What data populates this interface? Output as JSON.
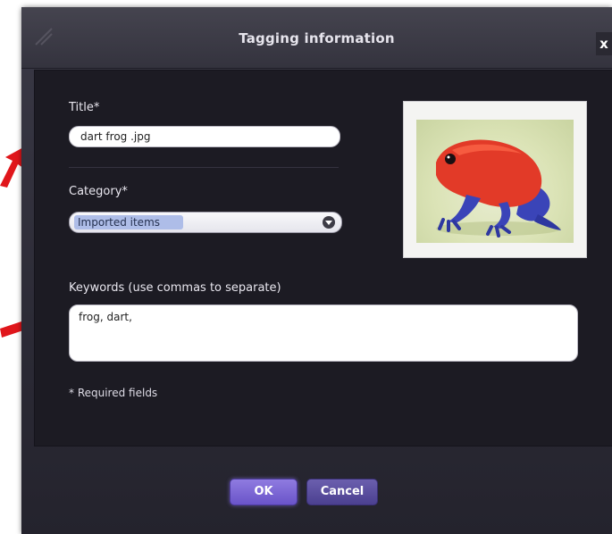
{
  "dialog": {
    "title": "Tagging information",
    "close_label": "x"
  },
  "form": {
    "title_label": "Title*",
    "title_value": "dart frog .jpg",
    "category_label": "Category*",
    "category_value": "Imported items",
    "keywords_label": "Keywords (use commas to separate)",
    "keywords_value": "frog, dart,",
    "required_note": "* Required fields"
  },
  "preview": {
    "image_subject": "red poison dart frog with blue legs"
  },
  "buttons": {
    "ok_label": "OK",
    "cancel_label": "Cancel"
  },
  "colors": {
    "annotation_arrow": "#e0161b",
    "ok_button": "#7a66d6",
    "cancel_button": "#5a4e9e"
  }
}
